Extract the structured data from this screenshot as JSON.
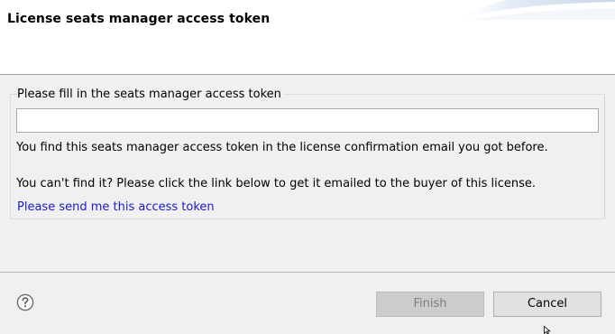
{
  "header": {
    "title": "License seats manager access token"
  },
  "group": {
    "legend": "Please fill in the seats manager access token",
    "token_input": {
      "value": "",
      "placeholder": ""
    },
    "info_line_1": "You find this seats manager  access token in the license confirmation email you got before.",
    "info_line_2": "You can't find it? Please click the link below to get it emailed to the buyer of this license.",
    "link_label": "Please send me this access token"
  },
  "footer": {
    "help_icon": "question-mark-circle",
    "finish_label": "Finish",
    "finish_enabled": false,
    "cancel_label": "Cancel"
  },
  "colors": {
    "link": "#1a1acf",
    "header_bg": "#ffffff",
    "body_bg": "#f0f0f0"
  }
}
